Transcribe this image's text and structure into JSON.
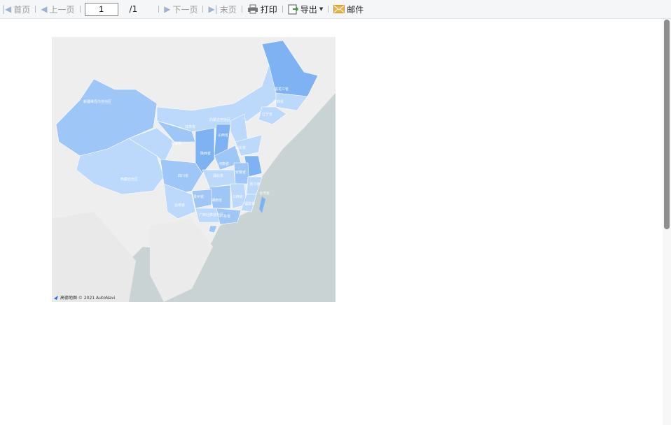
{
  "toolbar": {
    "first": "首页",
    "prev": "上一页",
    "page_value": "1",
    "total": "/1",
    "next": "下一页",
    "last": "末页",
    "print": "打印",
    "export": "导出",
    "mail": "邮件"
  },
  "map": {
    "attribution": "高德地图 © 2021 AutoNavi",
    "colors": {
      "light": "#bcd8fb",
      "mid": "#9ec6f6",
      "dark": "#7fb2f3",
      "land": "#eeeeee",
      "sea": "#c9d3d3"
    },
    "labels": {
      "xinjiang": "新疆维吾尔自治区",
      "xizang": "西藏自治区",
      "heilongjiang": "黑龙江省",
      "jilin": "吉林省",
      "liaoning": "辽宁省",
      "neimenggu": "内蒙古自治区",
      "shanxi": "山西省",
      "shaanxi": "陕西省",
      "qinghai": "青海省",
      "gansu": "甘肃省",
      "sichuan": "四川省",
      "hubei": "湖北省",
      "hunan": "湖南省",
      "jiangxi": "江西省",
      "guizhou": "贵州省",
      "yunnan": "云南省",
      "guangxi": "广西壮族自治区",
      "guangdong": "广东省",
      "shandong": "山东省",
      "henan": "河南省",
      "anhui": "安徽省",
      "zhejiang": "浙江省",
      "fujian": "福建省",
      "taiwan": "台湾省"
    }
  }
}
